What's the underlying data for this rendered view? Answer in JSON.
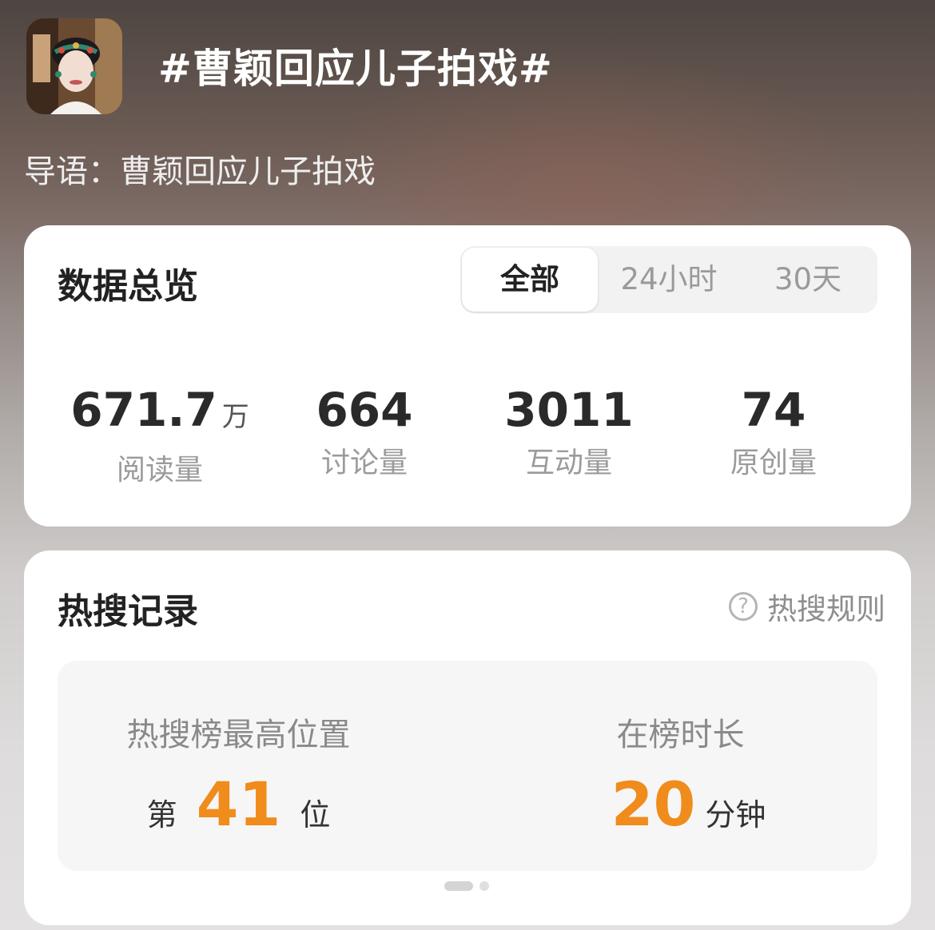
{
  "header": {
    "topic_title": "#曹颖回应儿子拍戏#",
    "lead_text": "导语：曹颖回应儿子拍戏"
  },
  "overview": {
    "title": "数据总览",
    "tabs": [
      {
        "label": "全部",
        "active": true
      },
      {
        "label": "24小时",
        "active": false
      },
      {
        "label": "30天",
        "active": false
      }
    ],
    "stats": [
      {
        "value": "671.7",
        "unit": "万",
        "label": "阅读量"
      },
      {
        "value": "664",
        "unit": "",
        "label": "讨论量"
      },
      {
        "value": "3011",
        "unit": "",
        "label": "互动量"
      },
      {
        "value": "74",
        "unit": "",
        "label": "原创量"
      }
    ]
  },
  "hot_search": {
    "title": "热搜记录",
    "rules_label": "热搜规则",
    "rules_icon": "question-circle-icon",
    "peak_position": {
      "label": "热搜榜最高位置",
      "prefix": "第",
      "value": "41",
      "suffix": "位"
    },
    "duration": {
      "label": "在榜时长",
      "value": "20",
      "suffix": "分钟"
    },
    "accent_color": "#f08c1c"
  }
}
